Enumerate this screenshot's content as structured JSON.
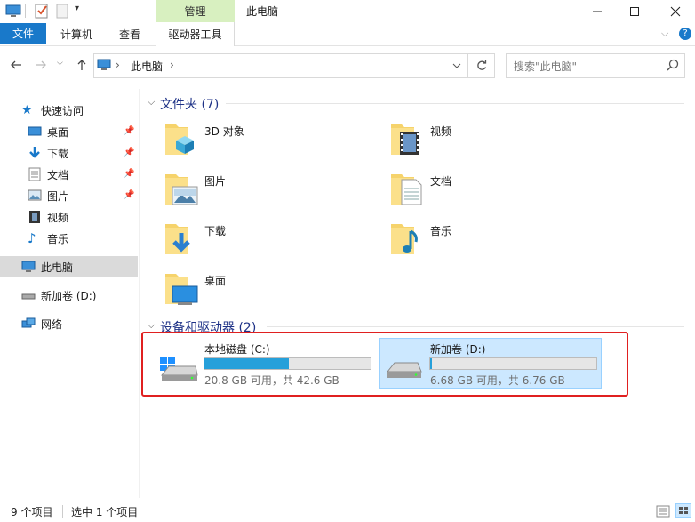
{
  "window": {
    "title": "此电脑",
    "context_tab": "管理"
  },
  "ribbon": {
    "tabs": [
      "文件",
      "计算机",
      "查看"
    ],
    "context_sub_tab": "驱动器工具"
  },
  "address": {
    "breadcrumb": "此电脑",
    "separator": "›",
    "search_placeholder": "搜索\"此电脑\""
  },
  "nav": {
    "quick_access": "快速访问",
    "items": [
      {
        "label": "桌面",
        "pinned": true
      },
      {
        "label": "下载",
        "pinned": true
      },
      {
        "label": "文档",
        "pinned": true
      },
      {
        "label": "图片",
        "pinned": true
      },
      {
        "label": "视频",
        "pinned": false
      },
      {
        "label": "音乐",
        "pinned": false
      }
    ],
    "this_pc": "此电脑",
    "drive": "新加卷 (D:)",
    "network": "网络"
  },
  "folders": {
    "header": "文件夹 (7)",
    "items": [
      "3D 对象",
      "视频",
      "图片",
      "文档",
      "下载",
      "音乐",
      "桌面"
    ]
  },
  "drives": {
    "header": "设备和驱动器 (2)",
    "items": [
      {
        "name": "本地磁盘 (C:)",
        "usage": "20.8 GB 可用，共 42.6 GB",
        "used_fraction": 0.51
      },
      {
        "name": "新加卷 (D:)",
        "usage": "6.68 GB 可用，共 6.76 GB",
        "used_fraction": 0.01
      }
    ]
  },
  "status": {
    "count": "9 个项目",
    "selection": "选中 1 个项目"
  },
  "colors": {
    "accent": "#1979ca",
    "bar_fill": "#26a0da",
    "selection": "#cce8ff",
    "highlight_box": "#e02020"
  }
}
